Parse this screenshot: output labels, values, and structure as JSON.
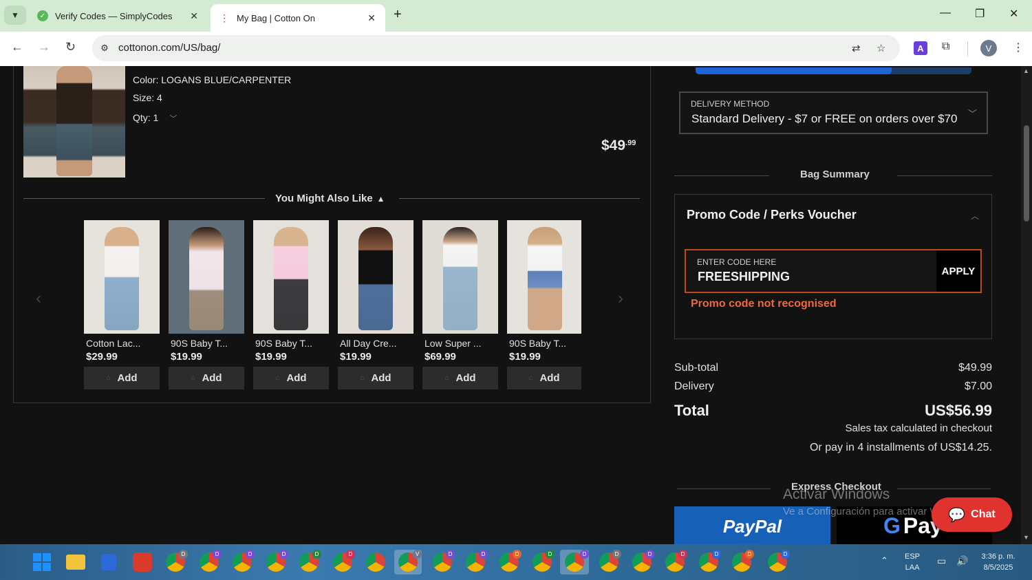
{
  "browser": {
    "tabs": [
      {
        "title": "Verify Codes — SimplyCodes",
        "active": false
      },
      {
        "title": "My Bag | Cotton On",
        "active": true
      }
    ],
    "url": "cottonon.com/US/bag/",
    "profile_initial": "V",
    "extension_letter": "A"
  },
  "cart_item": {
    "color": "Color: LOGANS BLUE/CARPENTER",
    "size": "Size: 4",
    "qty": "Qty: 1",
    "price_main": "$49",
    "price_cents": ".99"
  },
  "recommendations": {
    "title": "You Might Also Like",
    "items": [
      {
        "name": "Cotton Lac...",
        "price": "$29.99",
        "add": "Add"
      },
      {
        "name": "90S Baby T...",
        "price": "$19.99",
        "add": "Add"
      },
      {
        "name": "90S Baby T...",
        "price": "$19.99",
        "add": "Add"
      },
      {
        "name": "All Day Cre...",
        "price": "$19.99",
        "add": "Add"
      },
      {
        "name": "Low Super ...",
        "price": "$69.99",
        "add": "Add"
      },
      {
        "name": "90S Baby T...",
        "price": "$19.99",
        "add": "Add"
      }
    ]
  },
  "summary": {
    "free_shipping_progress": 0.71,
    "delivery_label": "DELIVERY METHOD",
    "delivery_value": "Standard Delivery - $7 or FREE on orders over $70",
    "bag_summary_title": "Bag Summary",
    "promo_title": "Promo Code / Perks Voucher",
    "promo_input_label": "ENTER CODE HERE",
    "promo_input_value": "FREESHIPPING",
    "apply_label": "APPLY",
    "promo_error": "Promo code not recognised",
    "subtotal_label": "Sub-total",
    "subtotal_value": "$49.99",
    "delivery_row_label": "Delivery",
    "delivery_row_value": "$7.00",
    "total_label": "Total",
    "total_value": "US$56.99",
    "tax_note": "Sales tax calculated in checkout",
    "installments_note": "Or pay in 4 installments of US$14.25.",
    "express_title": "Express Checkout",
    "paypal_label": "PayPal",
    "gpay_label": "Pay",
    "chat_label": "Chat"
  },
  "watermark": {
    "line1": "Activar Windows",
    "line2": "Ve a Configuración para activar Windows."
  },
  "taskbar": {
    "lang_top": "ESP",
    "lang_bottom": "LAA",
    "time": "3:36 p. m.",
    "date": "8/5/2025"
  },
  "colors": {
    "accent_blue": "#1e63d6",
    "error_orange": "#ef6a3a",
    "chat_red": "#e0322f",
    "paypal_blue": "#1660b8"
  }
}
